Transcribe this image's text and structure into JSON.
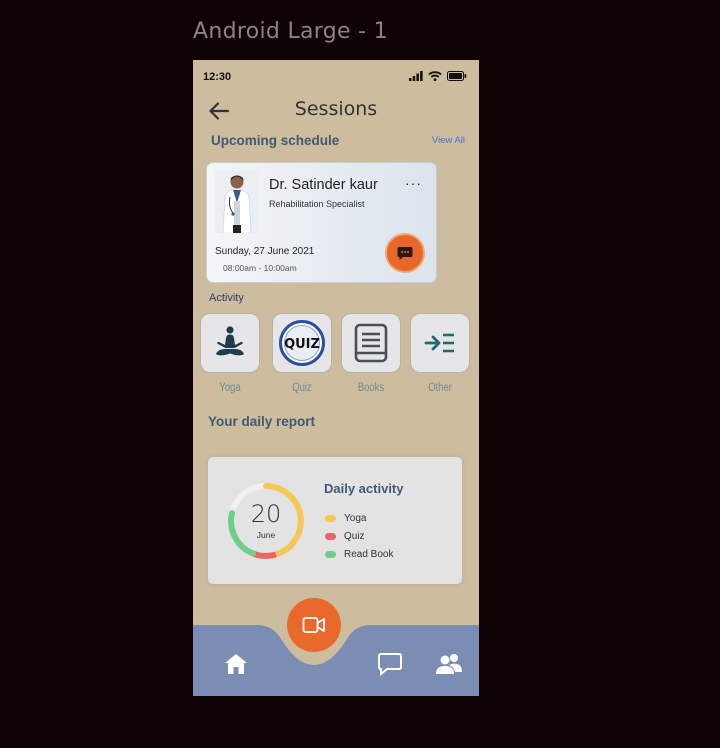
{
  "frame": {
    "label": "Android Large - 1"
  },
  "status_bar": {
    "time": "12:30"
  },
  "header": {
    "title": "Sessions"
  },
  "upcoming": {
    "heading": "Upcoming schedule",
    "view_all": "View All",
    "card": {
      "doctor_name": "Dr. Satinder kaur",
      "role": "Rehabilitation Specialist",
      "more": "···",
      "date": "Sunday, 27 June 2021",
      "time": "08:00am - 10:00am"
    }
  },
  "activity": {
    "heading": "Activity",
    "items": [
      {
        "label": "Yoga",
        "icon": "yoga-icon"
      },
      {
        "label": "Quiz",
        "icon": "quiz-icon"
      },
      {
        "label": "Books",
        "icon": "book-icon"
      },
      {
        "label": "Other",
        "icon": "other-icon"
      }
    ]
  },
  "daily_report": {
    "heading": "Your daily report",
    "day": "20",
    "month": "June",
    "title": "Daily activity",
    "legend": [
      {
        "label": "Yoga",
        "color": "#f6c85a"
      },
      {
        "label": "Quiz",
        "color": "#e86668"
      },
      {
        "label": "Read Book",
        "color": "#6fcf8a"
      }
    ]
  },
  "colors": {
    "background": "#cdbc9d",
    "nav": "#7c8db4",
    "accent": "#e8682a",
    "heading": "#3f5a73"
  },
  "bottom_nav": {
    "items": [
      "home-icon",
      "chat-icon",
      "users-icon"
    ],
    "center_button": "video-camera-icon"
  }
}
